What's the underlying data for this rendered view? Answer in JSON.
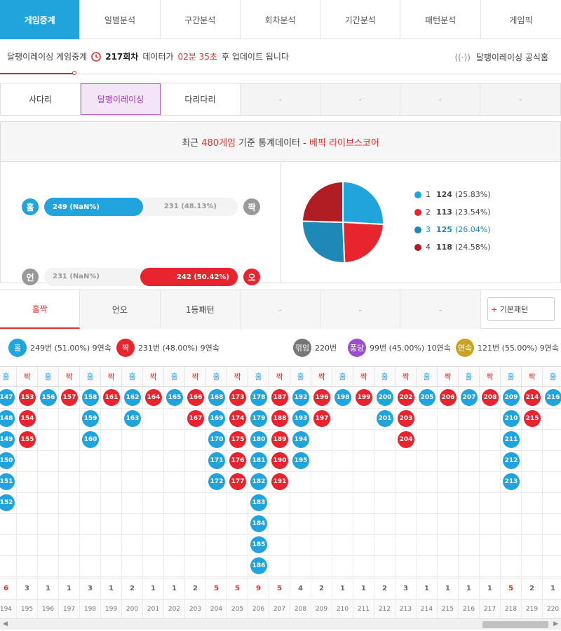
{
  "nav": {
    "tabs": [
      "게임중계",
      "일별분석",
      "구간분석",
      "회차분석",
      "기간분석",
      "패턴분석",
      "게임픽"
    ],
    "active": 0
  },
  "status": {
    "prefix": "달팽이레이싱 게임중계",
    "round": "217회차",
    "mid": "데이터가",
    "time": "02분 35초",
    "suffix": "후 업데이트 됩니다",
    "official": "달팽이레이싱 공식홈"
  },
  "game_tabs": [
    "사다리",
    "달팽이레이싱",
    "다리다리",
    "-",
    "-",
    "-",
    "-"
  ],
  "stats": {
    "title_pre": "최근",
    "title_count": "480게임",
    "title_mid": "기준 통계데이터 -",
    "title_brand": "베픽 라이브스코어",
    "row1": {
      "left_label": "홀",
      "left_value": "249 (NaN%)",
      "right_value": "231 (48.13%)",
      "right_label": "짝",
      "fill_ratio": 0.51
    },
    "row2": {
      "left_label": "언",
      "left_value": "231 (NaN%)",
      "right_value": "242 (50.42%)",
      "right_label": "오",
      "fill_ratio": 0.5042
    },
    "legend": [
      {
        "num": "1",
        "count": "124",
        "pct": "(25.83%)",
        "color": "#21a3dc"
      },
      {
        "num": "2",
        "count": "113",
        "pct": "(23.54%)",
        "color": "#e8242e"
      },
      {
        "num": "3",
        "count": "125",
        "pct": "(26.04%)",
        "color": "#1e88b6"
      },
      {
        "num": "4",
        "count": "118",
        "pct": "(24.58%)",
        "color": "#b01e24"
      }
    ],
    "pie_values": [
      124,
      113,
      125,
      118
    ]
  },
  "pattern_tabs": [
    "홀짝",
    "언오",
    "1등패턴",
    "-",
    "-",
    "-"
  ],
  "basic_pattern": {
    "plus": "+",
    "label": "기본패턴"
  },
  "summary": {
    "odd": {
      "icon": "홀",
      "text": "249번 (51.00%) 9연속"
    },
    "even": {
      "icon": "짝",
      "text": "231번 (48.00%) 9연속"
    },
    "switch": {
      "icon": "꺾임",
      "text": "220번"
    },
    "pong": {
      "icon": "퐁당",
      "text": "99번 (45.00%) 10연속"
    },
    "streak": {
      "icon": "연속",
      "text": "121번 (55.00%) 9연속"
    }
  },
  "pattern": {
    "columns": [
      {
        "h": "홀",
        "t": "o",
        "b": [
          "147",
          "148",
          "149",
          "150",
          "151",
          "152"
        ],
        "c": "6",
        "r": "194"
      },
      {
        "h": "짝",
        "t": "e",
        "b": [
          "153",
          "154",
          "155"
        ],
        "c": "3",
        "r": "195"
      },
      {
        "h": "홀",
        "t": "o",
        "b": [
          "156"
        ],
        "c": "1",
        "r": "196"
      },
      {
        "h": "짝",
        "t": "e",
        "b": [
          "157"
        ],
        "c": "1",
        "r": "197"
      },
      {
        "h": "홀",
        "t": "o",
        "b": [
          "158",
          "159",
          "160"
        ],
        "c": "3",
        "r": "198"
      },
      {
        "h": "짝",
        "t": "e",
        "b": [
          "161"
        ],
        "c": "1",
        "r": "199"
      },
      {
        "h": "홀",
        "t": "o",
        "b": [
          "162",
          "163"
        ],
        "c": "2",
        "r": "200"
      },
      {
        "h": "짝",
        "t": "e",
        "b": [
          "164"
        ],
        "c": "1",
        "r": "201"
      },
      {
        "h": "홀",
        "t": "o",
        "b": [
          "165"
        ],
        "c": "1",
        "r": "202"
      },
      {
        "h": "짝",
        "t": "e",
        "b": [
          "166",
          "167"
        ],
        "c": "2",
        "r": "203"
      },
      {
        "h": "홀",
        "t": "o",
        "b": [
          "168",
          "169",
          "170",
          "171",
          "172"
        ],
        "c": "5",
        "r": "204"
      },
      {
        "h": "짝",
        "t": "e",
        "b": [
          "173",
          "174",
          "175",
          "176",
          "177"
        ],
        "c": "5",
        "r": "205"
      },
      {
        "h": "홀",
        "t": "o",
        "b": [
          "178",
          "179",
          "180",
          "181",
          "182",
          "183",
          "184",
          "185",
          "186"
        ],
        "c": "9",
        "r": "206"
      },
      {
        "h": "짝",
        "t": "e",
        "b": [
          "187",
          "188",
          "189",
          "190",
          "191"
        ],
        "c": "5",
        "r": "207"
      },
      {
        "h": "홀",
        "t": "o",
        "b": [
          "192",
          "193",
          "194",
          "195"
        ],
        "c": "4",
        "r": "208"
      },
      {
        "h": "짝",
        "t": "e",
        "b": [
          "196",
          "197"
        ],
        "c": "2",
        "r": "209"
      },
      {
        "h": "홀",
        "t": "o",
        "b": [
          "198"
        ],
        "c": "1",
        "r": "210"
      },
      {
        "h": "짝",
        "t": "e",
        "b": [
          "199"
        ],
        "c": "1",
        "r": "211"
      },
      {
        "h": "홀",
        "t": "o",
        "b": [
          "200",
          "201"
        ],
        "c": "2",
        "r": "212"
      },
      {
        "h": "짝",
        "t": "e",
        "b": [
          "202",
          "203",
          "204"
        ],
        "c": "3",
        "r": "213"
      },
      {
        "h": "홀",
        "t": "o",
        "b": [
          "205"
        ],
        "c": "1",
        "r": "214"
      },
      {
        "h": "짝",
        "t": "e",
        "b": [
          "206"
        ],
        "c": "1",
        "r": "215"
      },
      {
        "h": "홀",
        "t": "o",
        "b": [
          "207"
        ],
        "c": "1",
        "r": "216"
      },
      {
        "h": "짝",
        "t": "e",
        "b": [
          "208"
        ],
        "c": "1",
        "r": "217"
      },
      {
        "h": "홀",
        "t": "o",
        "b": [
          "209",
          "210",
          "211",
          "212",
          "213"
        ],
        "c": "5",
        "r": "218"
      },
      {
        "h": "짝",
        "t": "e",
        "b": [
          "214",
          "215"
        ],
        "c": "2",
        "r": "219"
      },
      {
        "h": "홀",
        "t": "o",
        "b": [
          "216"
        ],
        "c": "1",
        "r": "220"
      }
    ]
  }
}
